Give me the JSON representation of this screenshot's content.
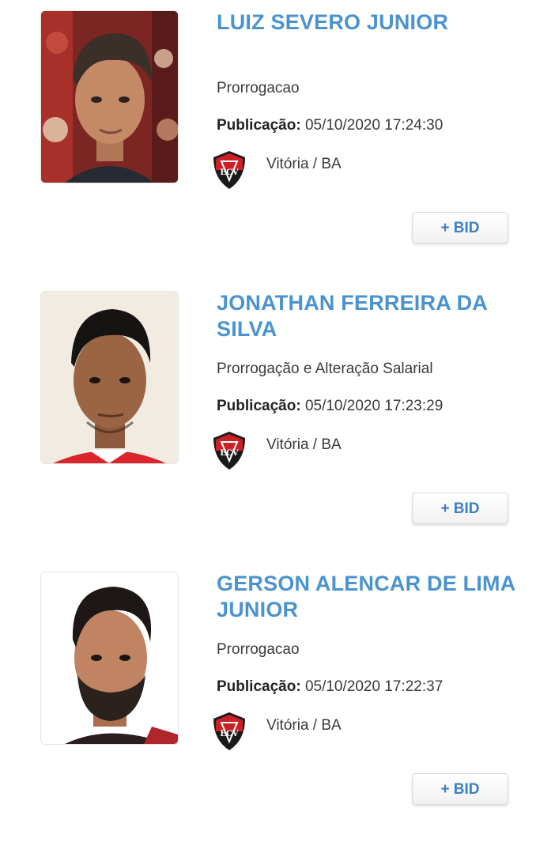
{
  "records": [
    {
      "name": "LUIZ SEVERO JUNIOR",
      "movement": "Prorrogacao",
      "publication_label": "Publicação:",
      "publication_date": "05/10/2020 17:24:30",
      "club": "Vitória / BA",
      "bid_label": "+ BID"
    },
    {
      "name": "JONATHAN FERREIRA DA SILVA",
      "movement": "Prorrogação e Alteração Salarial",
      "publication_label": "Publicação:",
      "publication_date": "05/10/2020 17:23:29",
      "club": "Vitória / BA",
      "bid_label": "+ BID"
    },
    {
      "name": "GERSON ALENCAR DE LIMA JUNIOR",
      "movement": "Prorrogacao",
      "publication_label": "Publicação:",
      "publication_date": "05/10/2020 17:22:37",
      "club": "Vitória / BA",
      "bid_label": "+ BID"
    }
  ],
  "colors": {
    "name_blue": "#4a93cf",
    "bid_blue": "#3d7fc0",
    "crest_red": "#cc1f26",
    "crest_black": "#1a1a1a"
  },
  "icons": [
    "player-photo",
    "club-crest-icon"
  ]
}
